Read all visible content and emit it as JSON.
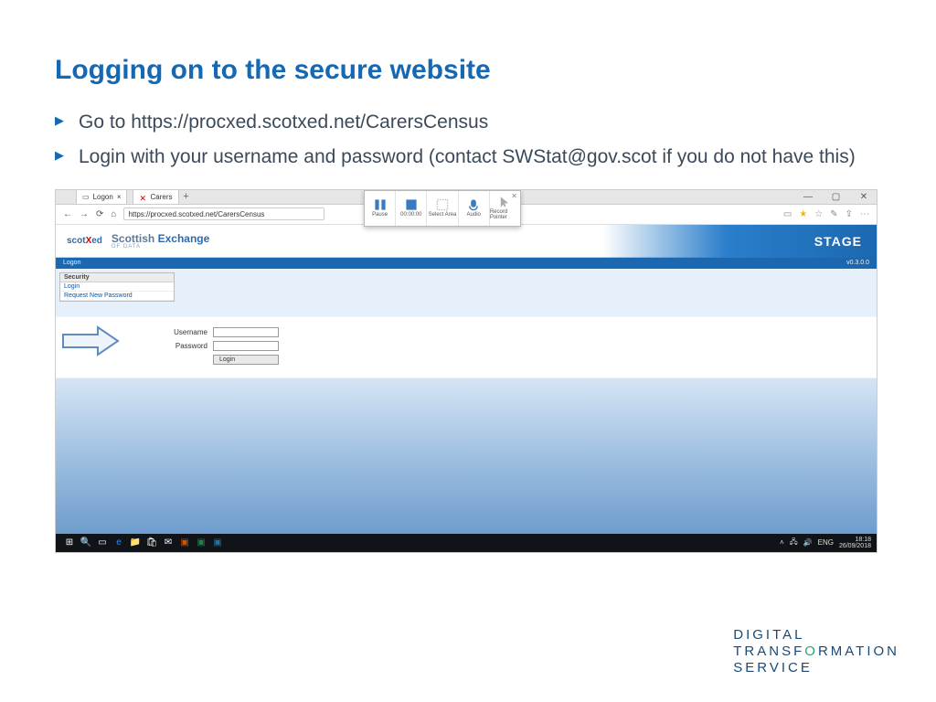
{
  "title": "Logging on to the secure website",
  "bullets": [
    "Go to https://procxed.scotxed.net/CarersCensus",
    "Login with your username and password (contact SWStat@gov.scot if you do not have this)"
  ],
  "browser": {
    "tab1": "Logon",
    "tab2": "Carers",
    "url": "https://procxed.scotxed.net/CarersCensus"
  },
  "recorder": {
    "pause": "Pause",
    "time": "00:00:00",
    "select": "Select Area",
    "audio": "Audio",
    "record": "Record Pointer"
  },
  "app": {
    "brand_scot": "scot",
    "brand_x": "X",
    "brand_ed": "ed",
    "title_scot": "Scottish",
    "title_ex": "Exchange",
    "title_sub": "OF DATA",
    "stage": "STAGE",
    "bar_left": "Logon",
    "bar_right": "v0.3.0.0"
  },
  "security": {
    "header": "Security",
    "login": "Login",
    "req": "Request New Password"
  },
  "form": {
    "user": "Username",
    "pass": "Password",
    "btn": "Login"
  },
  "taskbar": {
    "lang": "ENG",
    "time": "18:18",
    "date": "26/09/2018"
  },
  "footer": {
    "l1a": "DIGIT",
    "l1b": "A",
    "l1c": "L",
    "l2a": "TRANSF",
    "l2b": "O",
    "l2c": "RMATION",
    "l3": "SERVICE"
  }
}
